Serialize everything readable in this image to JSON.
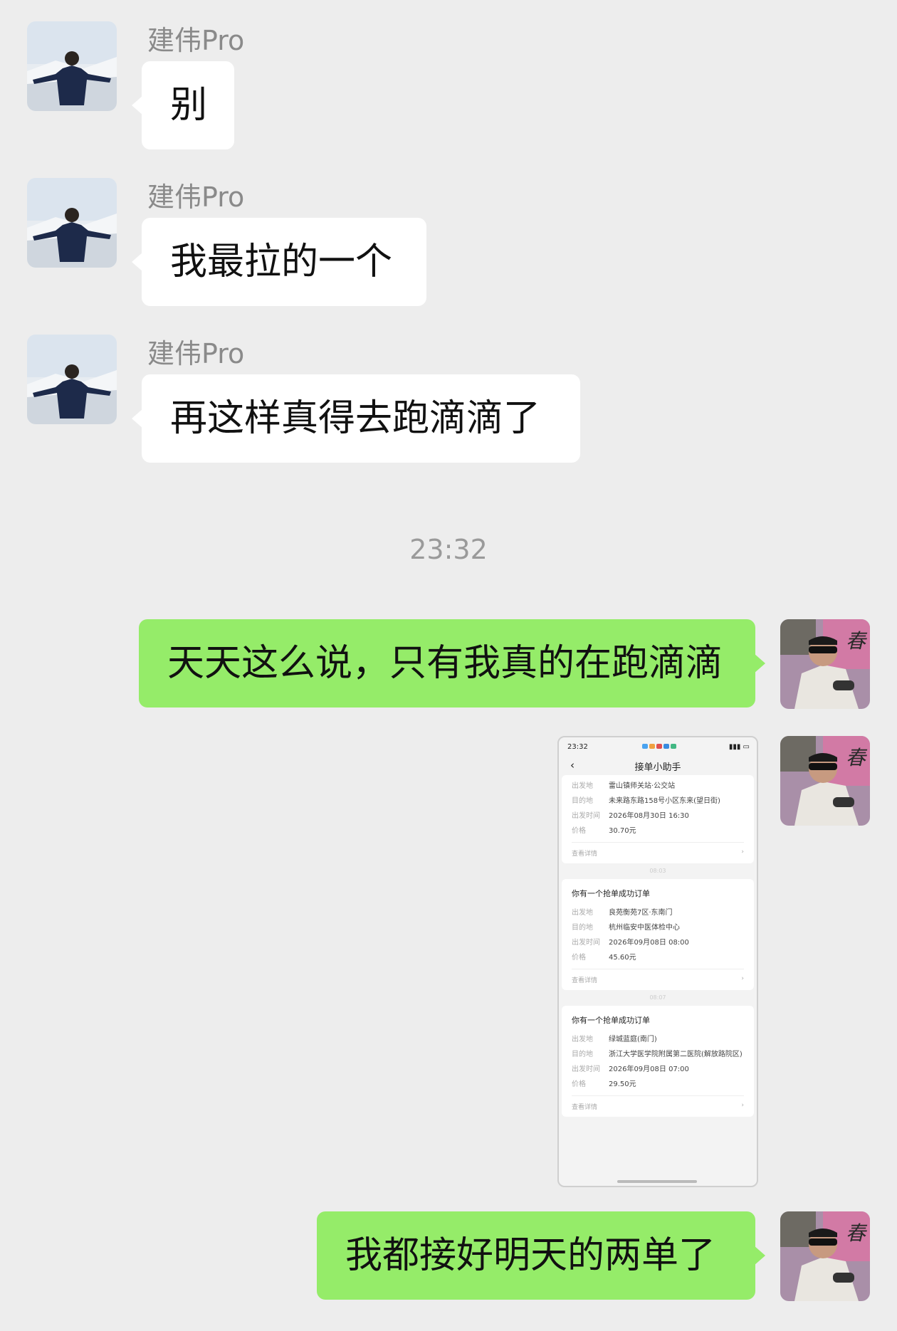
{
  "contact": {
    "name": "建伟Pro"
  },
  "messages_in": [
    {
      "sender": "建伟Pro",
      "text": "别"
    },
    {
      "sender": "建伟Pro",
      "text": "我最拉的一个"
    },
    {
      "sender": "建伟Pro",
      "text": "再这样真得去跑滴滴了"
    }
  ],
  "timestamp": "23:32",
  "messages_out": [
    {
      "text": "天天这么说，只有我真的在跑滴滴"
    },
    {
      "text": "我都接好明天的两单了"
    }
  ],
  "shared_screenshot": {
    "status_time": "23:32",
    "header_title": "接单小助手",
    "back_icon": "‹",
    "top_card": {
      "rows": [
        {
          "k": "出发地",
          "v": "雷山镇师关站·公交站"
        },
        {
          "k": "目的地",
          "v": "未来路东路158号小区东来(望日街)"
        },
        {
          "k": "出发时间",
          "v": "2026年08月30日 16:30"
        },
        {
          "k": "价格",
          "v": "30.70元"
        }
      ],
      "details": "查看详情"
    },
    "sep1": "08:03",
    "card2": {
      "title": "你有一个抢单成功订单",
      "rows": [
        {
          "k": "出发地",
          "v": "良苑衡苑7区·东南门"
        },
        {
          "k": "目的地",
          "v": "杭州临安中医体检中心"
        },
        {
          "k": "出发时间",
          "v": "2026年09月08日 08:00"
        },
        {
          "k": "价格",
          "v": "45.60元"
        }
      ],
      "details": "查看详情"
    },
    "sep2": "08:07",
    "card3": {
      "title": "你有一个抢单成功订单",
      "rows": [
        {
          "k": "出发地",
          "v": "绿城蓝庭(南门)"
        },
        {
          "k": "目的地",
          "v": "浙江大学医学院附属第二医院(解放路院区)"
        },
        {
          "k": "出发时间",
          "v": "2026年09月08日 07:00"
        },
        {
          "k": "价格",
          "v": "29.50元"
        }
      ],
      "details": "查看详情"
    },
    "chevron": "›"
  },
  "colors": {
    "background": "#ededed",
    "bubble_in": "#ffffff",
    "bubble_out": "#95ec69",
    "name": "#8a8a8a"
  }
}
